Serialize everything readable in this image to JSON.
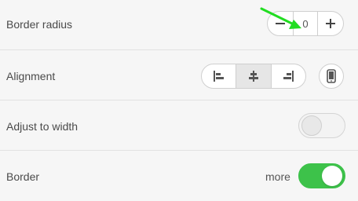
{
  "rows": {
    "border_radius": {
      "label": "Border radius",
      "value": "0"
    },
    "alignment": {
      "label": "Alignment",
      "selected": "center"
    },
    "adjust_to_width": {
      "label": "Adjust to width",
      "enabled": false
    },
    "border": {
      "label": "Border",
      "more_label": "more",
      "enabled": true
    }
  },
  "icons": {
    "minus": "minus-icon",
    "plus": "plus-icon",
    "align_left": "align-left-icon",
    "align_center": "align-center-icon",
    "align_right": "align-right-icon",
    "mobile": "mobile-phone-icon",
    "annotation": "green-arrow"
  },
  "colors": {
    "toggle_on": "#3dc24a",
    "annotation_arrow": "#22dd22"
  }
}
